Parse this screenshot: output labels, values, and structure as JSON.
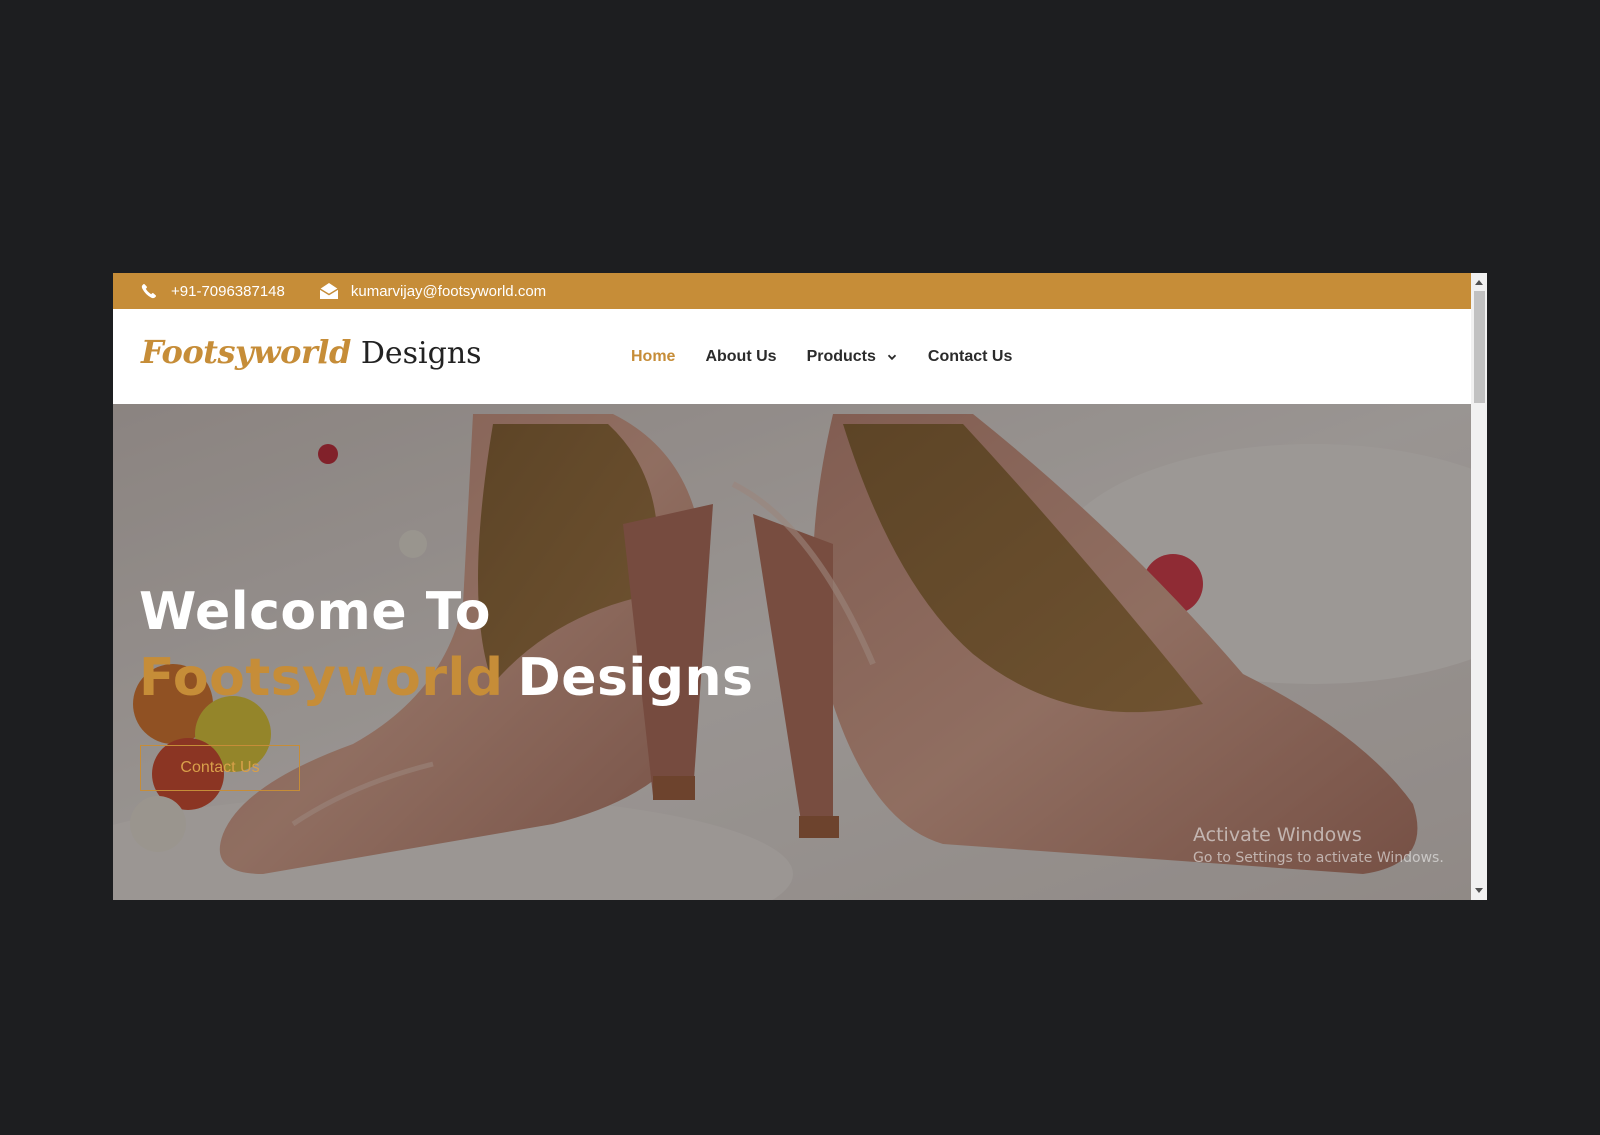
{
  "topbar": {
    "phone": "+91-7096387148",
    "email": "kumarvijay@footsyworld.com",
    "background_color": "#c68d38",
    "icons": [
      "phone-icon",
      "envelope-icon"
    ]
  },
  "header": {
    "logo_script": "Footsyworld",
    "logo_plain": "Designs",
    "nav": [
      {
        "label": "Home",
        "active": true
      },
      {
        "label": "About Us",
        "active": false
      },
      {
        "label": "Products",
        "active": false,
        "dropdown": true
      },
      {
        "label": "Contact Us",
        "active": false
      }
    ]
  },
  "hero": {
    "title_line1": "Welcome To",
    "title_line2_accent": "Footsyworld",
    "title_line2_rest": "Designs",
    "cta_label": "Contact Us",
    "accent_color": "#c68d38"
  },
  "watermark": {
    "line1": "Activate Windows",
    "line2": "Go to Settings to activate Windows."
  }
}
